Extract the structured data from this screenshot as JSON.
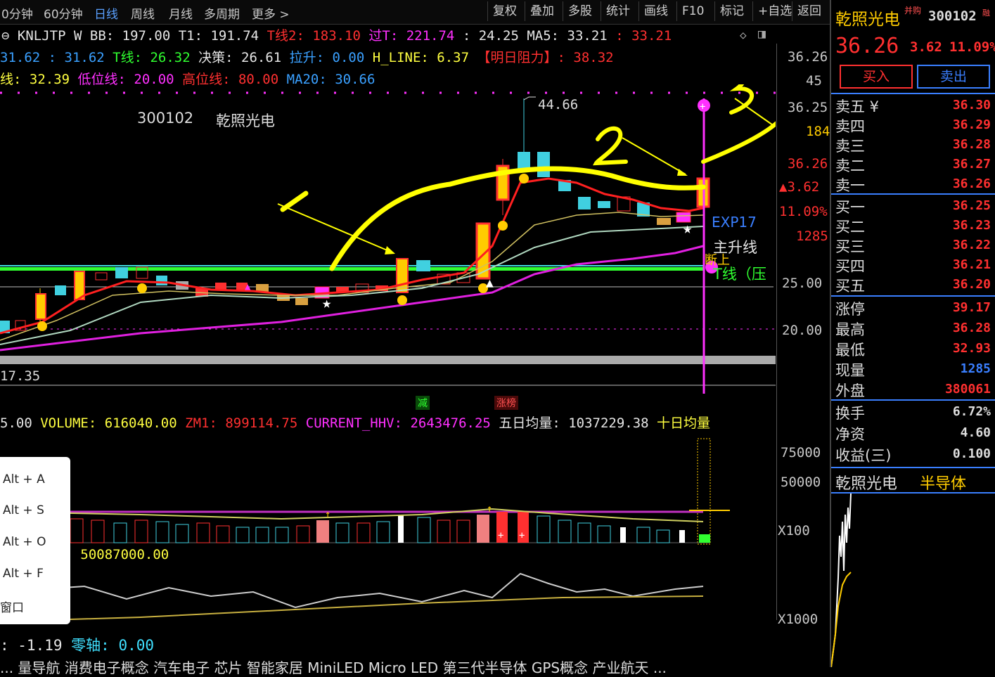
{
  "toolbar": {
    "tabs": [
      "0分钟",
      "60分钟",
      "日线",
      "周线",
      "月线",
      "多周期",
      "更多 >"
    ],
    "buttons": [
      "复权",
      "叠加",
      "多股",
      "统计",
      "画线",
      "F10",
      "标记",
      "+自选",
      "返回"
    ]
  },
  "indicator_line1": {
    "name": "KNLJTP",
    "w": "W",
    "bb": "BB: 197.00",
    "t1": "T1: 191.74",
    "t2": "T线2: 183.10",
    "guot": "过T: 221.74",
    "colon_val": ": 24.25",
    "ma5": "MA5: 33.21",
    "ma5b": ": 33.21"
  },
  "indicator_line2": {
    "a": "31.62 : 31.62",
    "tline": "T线: 26.32",
    "juece": "决策: 26.61",
    "lasheng": "拉升: 0.00",
    "hline": "H_LINE: 6.37",
    "resist": "【明日阻力】: 38.32"
  },
  "indicator_line3": {
    "a": "线: 32.39",
    "low": "低位线: 20.00",
    "high": "高位线: 80.00",
    "ma20": "MA20: 30.66"
  },
  "chart_title": {
    "code": "300102",
    "name": "乾照光电"
  },
  "price_labels": {
    "high": "44.66",
    "exp": "EXP17",
    "main_up": "主升线",
    "duan": "断上",
    "tline": "T线（压",
    "low": "17.35"
  },
  "annotations": {
    "n1": "1",
    "n2": "2",
    "n3": "3"
  },
  "badges": {
    "jian": "减",
    "zhang": "涨榜"
  },
  "right_axis": {
    "p1": "36.26",
    "p2": "45",
    "p3": "36.25",
    "p4": "184",
    "p5": "36.26",
    "p6": "▲3.62",
    "p7": "11.09%",
    "p8": "1285",
    "p9": "25.00",
    "p10": "20.00"
  },
  "volume_line": {
    "a": "5.00",
    "vol": "VOLUME: 616040.00",
    "zm1": "ZM1: 899114.75",
    "hhv": "CURRENT_HHV: 2643476.25",
    "avg5": "五日均量: 1037229.38",
    "avg10": "十日均量"
  },
  "volume_axis": {
    "v1": "75000",
    "v2": "50000",
    "v3": "X100"
  },
  "obv_line": {
    "a": "00 MAOBV: 50087000.00"
  },
  "obv_axis": {
    "v1": "X1000"
  },
  "bottom_line": {
    "a": ": -1.19",
    "zero": "零轴: 0.00"
  },
  "bottom_tags": "... 量导航  消费电子概念  汽车电子  芯片  智能家居  MiniLED  Micro LED  第三代半导体  GPS概念  产业航天 ...",
  "popup": {
    "items": [
      "Alt + A",
      "Alt + S",
      "Alt + O",
      "Alt + F",
      "窗口"
    ]
  },
  "rpanel": {
    "name": "乾照光电",
    "tag": "并购",
    "code": "300102",
    "tag2": "融",
    "price": "36.26",
    "change": "3.62",
    "pct": "11.09%",
    "buy": "买入",
    "sell": "卖出",
    "asks": [
      {
        "label": "卖五 ¥",
        "price": "36.30"
      },
      {
        "label": "卖四",
        "price": "36.29"
      },
      {
        "label": "卖三",
        "price": "36.28"
      },
      {
        "label": "卖二",
        "price": "36.27"
      },
      {
        "label": "卖一",
        "price": "36.26"
      }
    ],
    "bids": [
      {
        "label": "买一",
        "price": "36.25"
      },
      {
        "label": "买二",
        "price": "36.23"
      },
      {
        "label": "买三",
        "price": "36.22"
      },
      {
        "label": "买四",
        "price": "36.21"
      },
      {
        "label": "买五",
        "price": "36.20"
      }
    ],
    "stats1": [
      {
        "label": "涨停",
        "value": "39.17"
      },
      {
        "label": "最高",
        "value": "36.28"
      },
      {
        "label": "最低",
        "value": "32.93"
      },
      {
        "label": "现量",
        "value": "1285"
      },
      {
        "label": "外盘",
        "value": "380061"
      }
    ],
    "stats2": [
      {
        "label": "换手",
        "value": "6.72%"
      },
      {
        "label": "净资",
        "value": "4.60"
      },
      {
        "label": "收益(三)",
        "value": "0.100"
      }
    ],
    "footer_name": "乾照光电",
    "footer_sector": "半导体"
  },
  "colors": {
    "up": "#ff3030",
    "down": "#40d0e0",
    "yellow": "#ffff00",
    "magenta": "#ff30ff"
  }
}
